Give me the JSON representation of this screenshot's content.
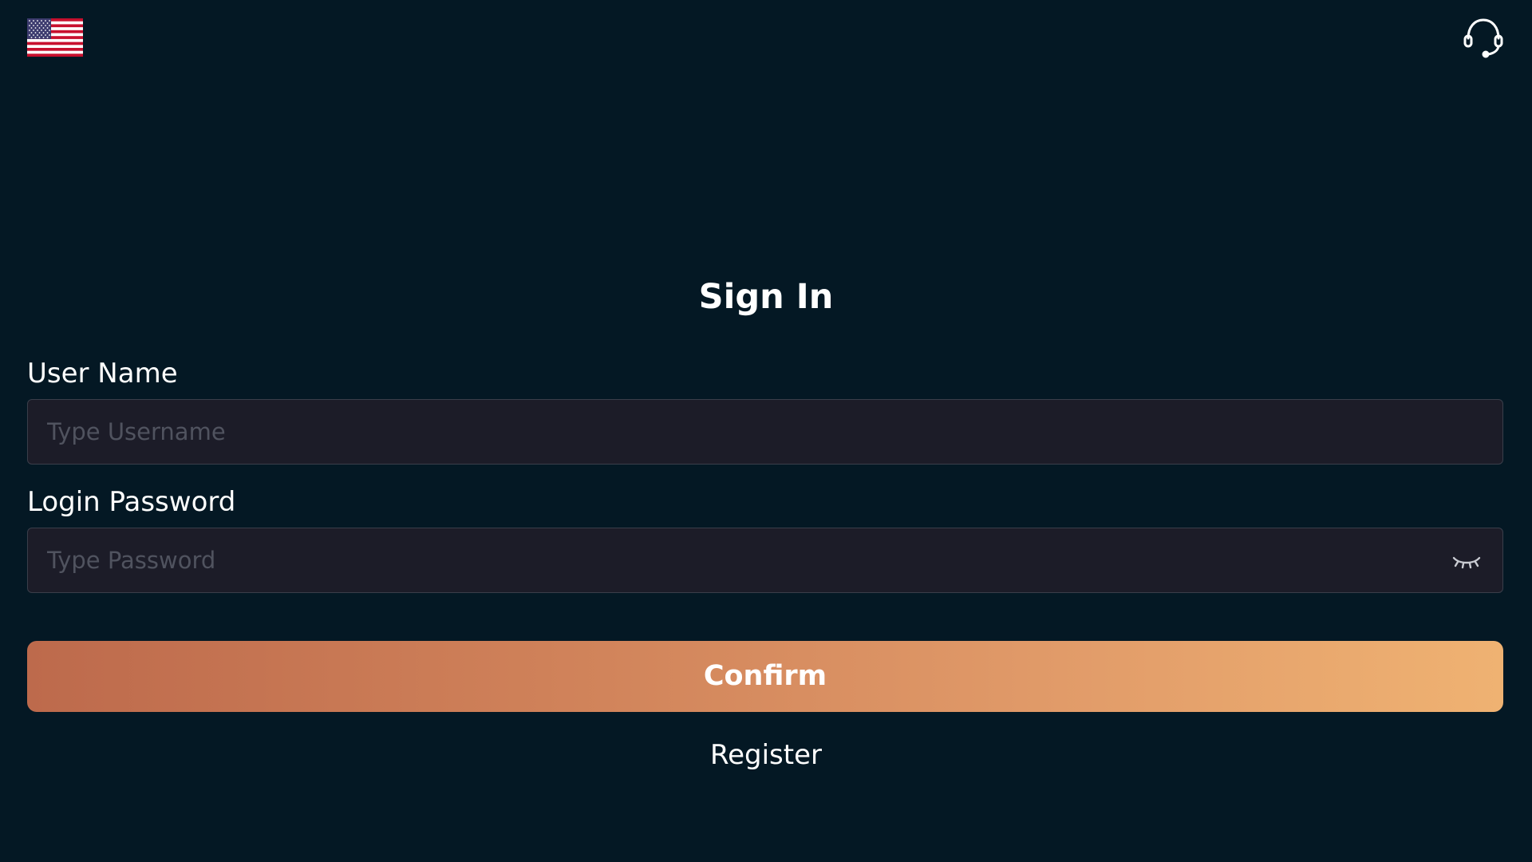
{
  "header": {
    "language_icon": "us-flag-icon",
    "support_icon": "headset-icon"
  },
  "form": {
    "title": "Sign In",
    "username": {
      "label": "User Name",
      "placeholder": "Type Username",
      "value": ""
    },
    "password": {
      "label": "Login Password",
      "placeholder": "Type Password",
      "value": "",
      "toggle_icon": "eye-closed-icon"
    },
    "confirm_label": "Confirm",
    "register_label": "Register"
  },
  "colors": {
    "background": "#041824",
    "field_background": "#1c1c28",
    "button_gradient_start": "#bd6a4c",
    "button_gradient_end": "#efb272"
  }
}
